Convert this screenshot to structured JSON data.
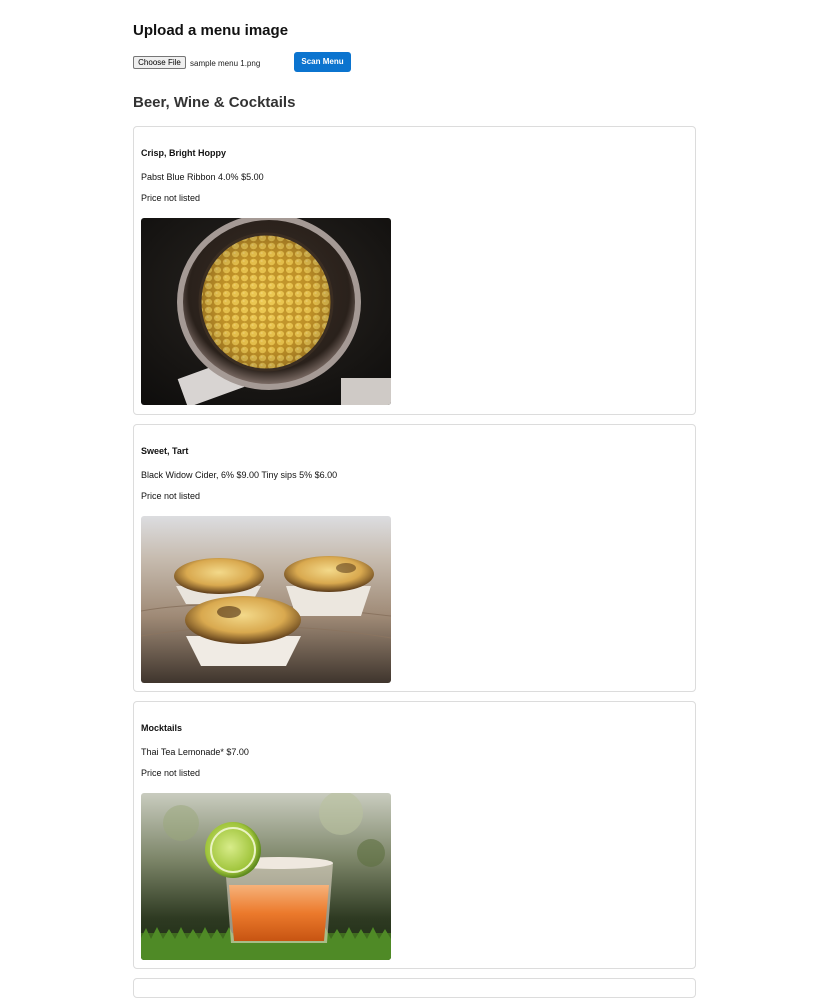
{
  "upload": {
    "title": "Upload a menu image",
    "choose_file_label": "Choose File",
    "selected_file": "sample menu 1.png",
    "scan_button_label": "Scan Menu"
  },
  "section": {
    "title": "Beer, Wine & Cocktails"
  },
  "items": [
    {
      "heading": "Crisp, Bright Hoppy",
      "description": "Pabst Blue Ribbon 4.0% $5.00",
      "price": "Price not listed",
      "photo_icon": "corn-in-pan-photo"
    },
    {
      "heading": "Sweet, Tart",
      "description": "Black Widow Cider, 6% $9.00 Tiny sips 5% $6.00",
      "price": "Price not listed",
      "photo_icon": "egg-tarts-photo"
    },
    {
      "heading": "Mocktails",
      "description": "Thai Tea Lemonade* $7.00",
      "price": "Price not listed",
      "photo_icon": "orange-drink-with-lime-photo"
    }
  ],
  "colors": {
    "scan_button": "#0b74cf",
    "card_border": "#dcdcdc",
    "section_title": "#333333"
  }
}
